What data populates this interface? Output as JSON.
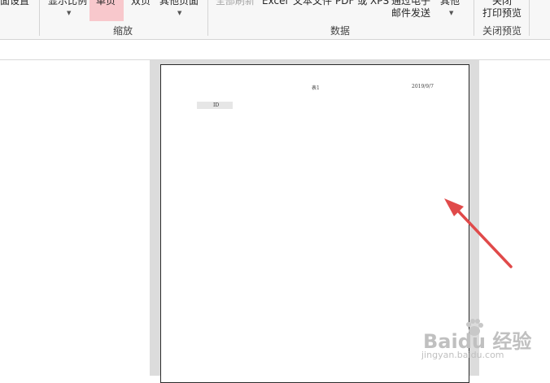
{
  "ribbon": {
    "buttons": {
      "page_setup": "面设置",
      "zoom_ratio": "显示比例",
      "single_page": "单页",
      "two_pages": "双页",
      "more_pages": "其他页面",
      "refresh_all": "全部刷新",
      "excel": "Excel",
      "text_file": "文本文件",
      "pdf_xps": "PDF 或 XPS",
      "email_line1": "通过电子",
      "email_line2": "邮件发送",
      "more": "其他",
      "close_line1": "关闭",
      "close_line2": "打印预览"
    },
    "groups": {
      "zoom": "缩放",
      "data": "数据",
      "close_preview": "关闭预览"
    }
  },
  "page": {
    "header_title": "表1",
    "header_date": "2019/9/7",
    "column_header": "ID"
  },
  "watermark": {
    "brand": "Baidu 经验",
    "url": "jingyan.baidu.com"
  },
  "colors": {
    "highlight": "#f8c8cc",
    "annotation_arrow": "#e04a4a",
    "backdrop": "#dcdcdc"
  }
}
